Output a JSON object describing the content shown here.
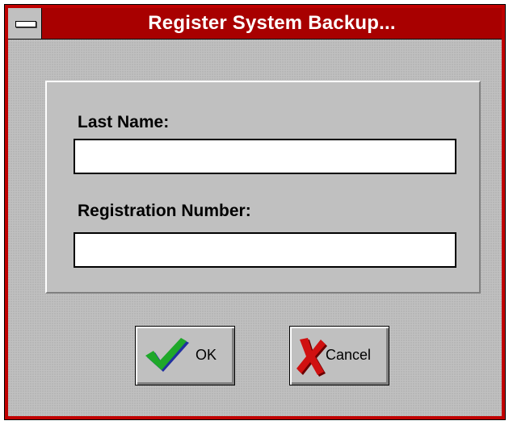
{
  "window": {
    "title": "Register System Backup..."
  },
  "form": {
    "last_name_label": "Last Name:",
    "last_name_value": "",
    "registration_label": "Registration Number:",
    "registration_value": ""
  },
  "buttons": {
    "ok_label": "OK",
    "cancel_label": "Cancel"
  },
  "icons": {
    "ok": "checkmark-icon",
    "cancel": "x-mark-icon",
    "system_menu": "system-menu-icon"
  },
  "colors": {
    "titlebar": "#a80000",
    "frame": "#c00000",
    "face": "#c0c0c0",
    "check_green": "#1fa82a",
    "check_blue": "#2030a0",
    "x_red": "#d01010"
  }
}
